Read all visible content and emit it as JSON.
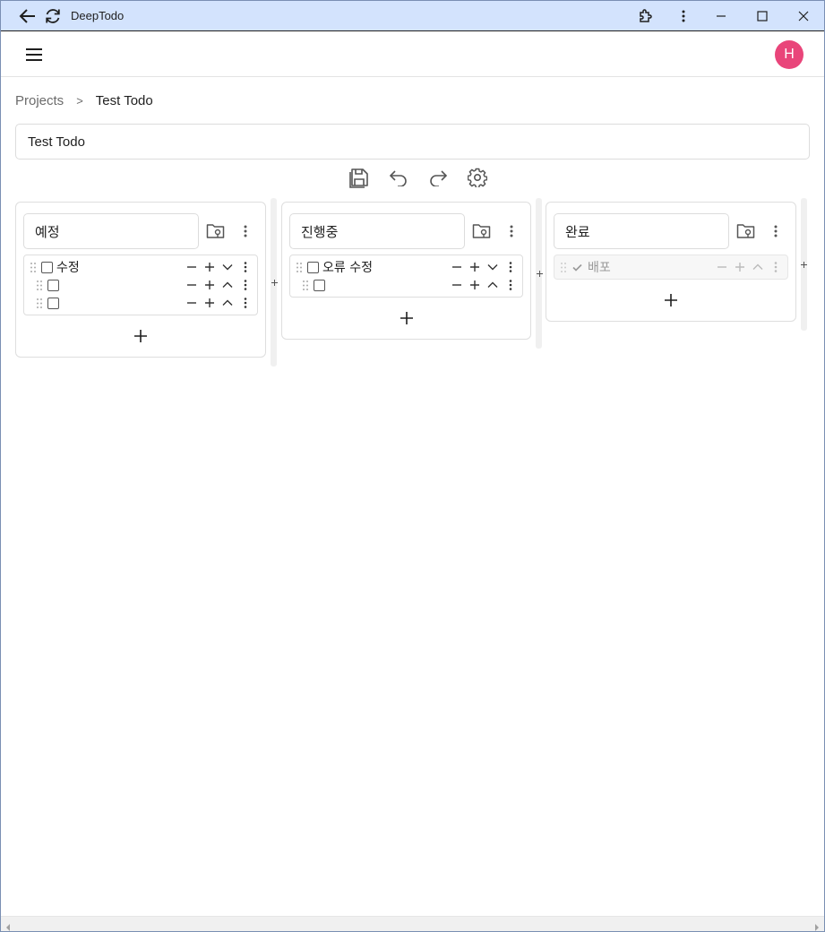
{
  "window": {
    "title": "DeepTodo"
  },
  "header": {
    "avatar_initial": "H"
  },
  "breadcrumb": {
    "root": "Projects",
    "separator": ">",
    "current": "Test Todo"
  },
  "project": {
    "title_value": "Test Todo"
  },
  "colors": {
    "accent_avatar": "#e9457a",
    "titlebar_bg": "#d3e3fd"
  },
  "toolbar": {
    "icons": [
      "save-icon",
      "undo-icon",
      "redo-icon",
      "settings-icon"
    ]
  },
  "columns": [
    {
      "name": "예정",
      "items": [
        {
          "text": "수정",
          "checked": false,
          "level": 0,
          "expand": "down"
        },
        {
          "text": "",
          "checked": false,
          "level": 1,
          "expand": "up"
        },
        {
          "text": "",
          "checked": false,
          "level": 1,
          "expand": "up"
        }
      ]
    },
    {
      "name": "진행중",
      "items": [
        {
          "text": "오류 수정",
          "checked": false,
          "level": 0,
          "expand": "down"
        },
        {
          "text": "",
          "checked": false,
          "level": 1,
          "expand": "up"
        }
      ]
    },
    {
      "name": "완료",
      "items": [
        {
          "text": "배포",
          "checked": true,
          "level": 0,
          "expand": "up"
        }
      ]
    }
  ]
}
